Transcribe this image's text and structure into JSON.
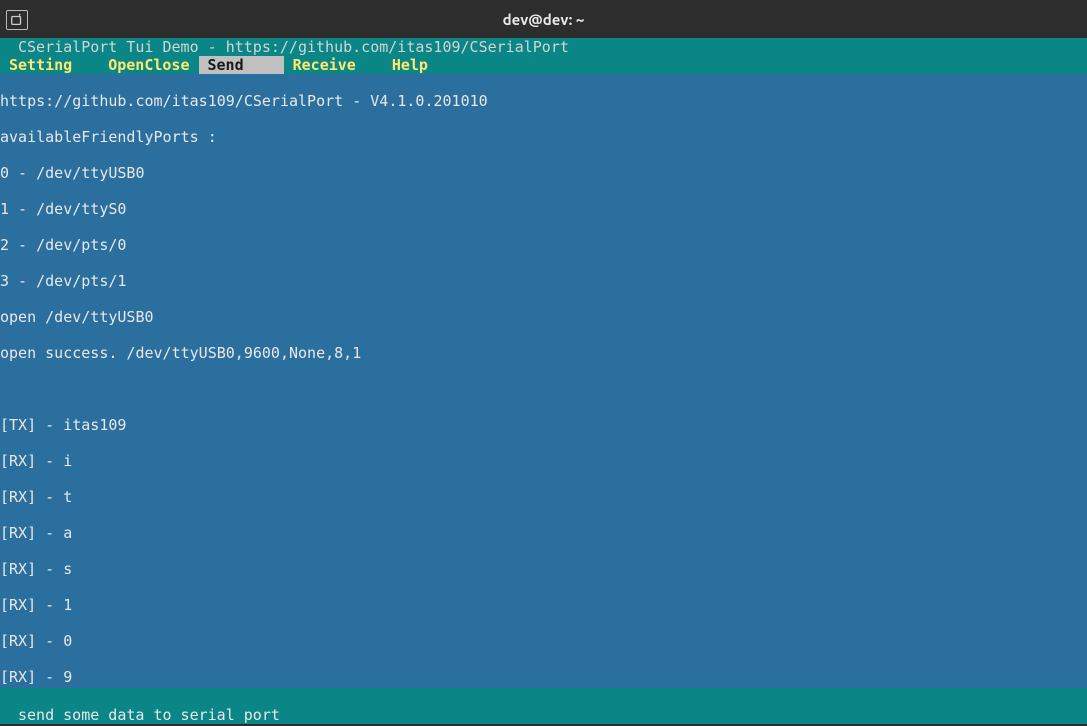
{
  "window": {
    "title": "dev@dev: ~"
  },
  "app": {
    "header": "CSerialPort Tui Demo - https://github.com/itas109/CSerialPort"
  },
  "menubar": {
    "items": [
      {
        "label": "Setting",
        "active": false
      },
      {
        "label": "OpenClose",
        "active": false
      },
      {
        "label": "Send",
        "active": true
      },
      {
        "label": "Receive",
        "active": false
      },
      {
        "label": "Help",
        "active": false
      }
    ]
  },
  "terminal": {
    "lines": [
      "https://github.com/itas109/CSerialPort - V4.1.0.201010",
      "availableFriendlyPorts :",
      "0 - /dev/ttyUSB0",
      "1 - /dev/ttyS0",
      "2 - /dev/pts/0",
      "3 - /dev/pts/1",
      "open /dev/ttyUSB0",
      "open success. /dev/ttyUSB0,9600,None,8,1",
      "",
      "[TX] - itas109",
      "[RX] - i",
      "[RX] - t",
      "[RX] - a",
      "[RX] - s",
      "[RX] - 1",
      "[RX] - 0",
      "[RX] - 9"
    ]
  },
  "statusbar": {
    "text": "send some data to serial port"
  }
}
